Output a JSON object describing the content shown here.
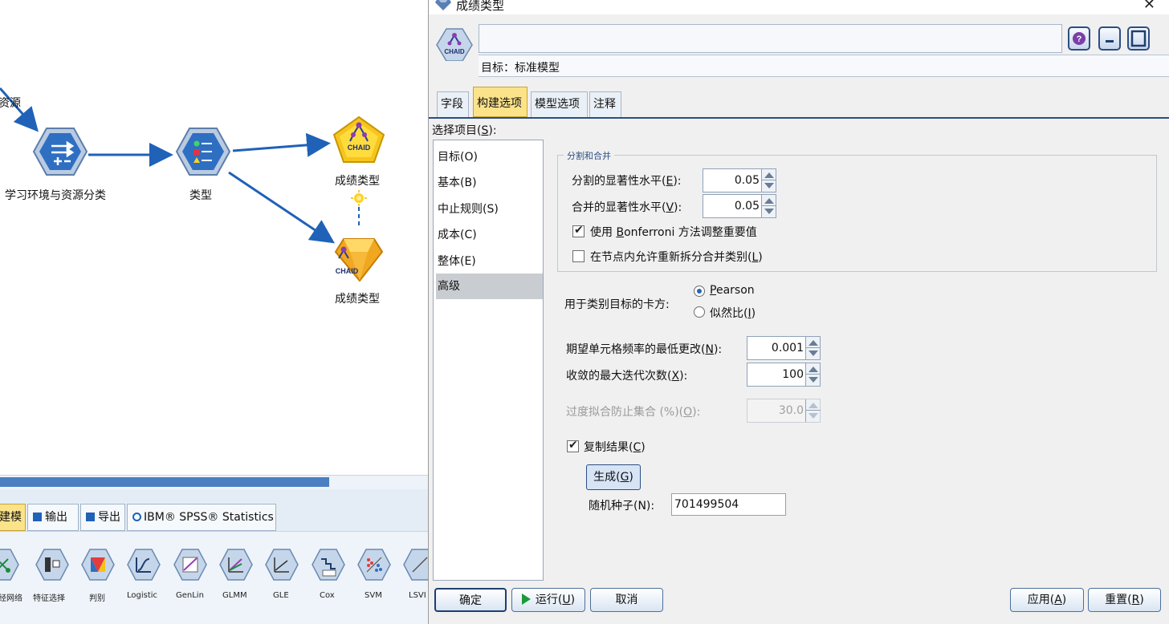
{
  "canvas": {
    "partial_source_label": "资源",
    "nodes": [
      {
        "label": "学习环境与资源分类",
        "icon": "derive-node-icon"
      },
      {
        "label": "类型",
        "icon": "type-node-icon"
      },
      {
        "label": "成绩类型",
        "icon": "chaid-modeler-icon",
        "badge": "CHAID"
      },
      {
        "label": "成绩类型",
        "icon": "chaid-nugget-icon",
        "badge": "CHAID"
      }
    ]
  },
  "palette": {
    "tabs": [
      {
        "label": "建模",
        "active": true
      },
      {
        "label": "输出"
      },
      {
        "label": "导出"
      },
      {
        "label": "IBM® SPSS® Statistics"
      }
    ],
    "items": [
      {
        "label": "经网络",
        "icon": "neural-net-icon"
      },
      {
        "label": "特征选择",
        "icon": "feature-selection-icon"
      },
      {
        "label": "判别",
        "icon": "discriminant-icon"
      },
      {
        "label": "Logistic",
        "icon": "logistic-icon"
      },
      {
        "label": "GenLin",
        "icon": "genlin-icon"
      },
      {
        "label": "GLMM",
        "icon": "glmm-icon"
      },
      {
        "label": "GLE",
        "icon": "gle-icon"
      },
      {
        "label": "Cox",
        "icon": "cox-icon"
      },
      {
        "label": "SVM",
        "icon": "svm-icon"
      },
      {
        "label": "LSVI",
        "icon": "lsvm-icon"
      }
    ]
  },
  "dialog": {
    "title": "成绩类型",
    "node_badge": "CHAID",
    "target_text": "目标：标准模型",
    "tabs": [
      {
        "label": "字段"
      },
      {
        "label": "构建选项",
        "active": true
      },
      {
        "label": "模型选项"
      },
      {
        "label": "注释"
      }
    ],
    "select_label": "选择项目(",
    "select_key": "S",
    "select_suffix": "):",
    "select_items": [
      {
        "label": "目标(O)"
      },
      {
        "label": "基本(B)"
      },
      {
        "label": "中止规则(S)"
      },
      {
        "label": "成本(C)"
      },
      {
        "label": "整体(E)"
      },
      {
        "label": "高级",
        "selected": true
      }
    ],
    "group_title": "分割和合并",
    "split_label": "分割的显著性水平(",
    "split_key": "E",
    "split_suffix": "):",
    "split_value": "0.05",
    "merge_label": "合并的显著性水平(",
    "merge_key": "V",
    "merge_suffix": "):",
    "merge_value": "0.05",
    "bonferroni_prefix": "使用 ",
    "bonferroni_key": "B",
    "bonferroni_rest": "onferroni 方法调整重要值",
    "bonferroni_checked": true,
    "resplit_label": "在节点内允许重新拆分合并类别(",
    "resplit_key": "L",
    "resplit_suffix": ")",
    "resplit_checked": false,
    "chisq_label": "用于类别目标的卡方:",
    "pearson_key": "P",
    "pearson_rest": "earson",
    "pearson_selected": true,
    "likelihood_label": "似然比(",
    "likelihood_key": "I",
    "likelihood_suffix": ")",
    "min_change_label": "期望单元格频率的最低更改(",
    "min_change_key": "N",
    "min_change_suffix": "):",
    "min_change_value": "0.001",
    "max_iter_label": "收敛的最大迭代次数(",
    "max_iter_key": "X",
    "max_iter_suffix": "):",
    "max_iter_value": "100",
    "overfit_label": "过度拟合防止集合 (%)(",
    "overfit_key": "O",
    "overfit_suffix": "):",
    "overfit_value": "30.0",
    "replicate_label": "复制结果(",
    "replicate_key": "C",
    "replicate_suffix": ")",
    "replicate_checked": true,
    "generate_label": "生成(",
    "generate_key": "G",
    "generate_suffix": ")",
    "seed_label": "随机种子(N):",
    "seed_value": "701499504",
    "buttons": {
      "ok": "确定",
      "run": "运行(",
      "run_key": "U",
      "run_suffix": ")",
      "cancel": "取消",
      "apply": "应用(",
      "apply_key": "A",
      "apply_suffix": ")",
      "reset": "重置(",
      "reset_key": "R",
      "reset_suffix": ")"
    }
  }
}
